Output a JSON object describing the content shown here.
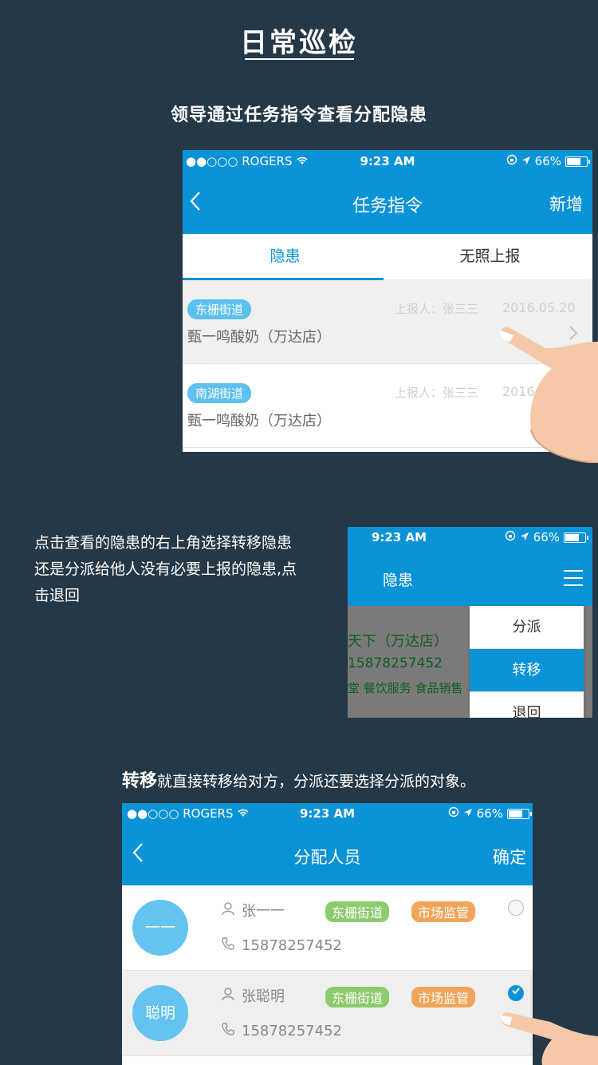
{
  "page": {
    "title": "日常巡检",
    "section1_heading": "领导通过任务指令查看分配隐患",
    "section2_text": "点击查看的隐患的右上角选择转移隐患还是分派给他人没有必要上报的隐患,点击退回",
    "section3_heading_bold": "转移",
    "section3_heading_rest": "就直接转移给对方，分派还要选择分派的对象。"
  },
  "status_bar": {
    "carrier": "●●○○○ ROGERS",
    "time": "9:23 AM",
    "battery": "66%"
  },
  "phone1": {
    "nav_title": "任务指令",
    "nav_action": "新增",
    "tabs": [
      "隐患",
      "无照上报"
    ],
    "items": [
      {
        "tag": "东栅街道",
        "reporter": "上报人：张三三",
        "date": "2016.05.20",
        "shop": "甄一鸣酸奶（万达店）"
      },
      {
        "tag": "南湖街道",
        "reporter": "上报人：张三三",
        "date": "2016",
        "shop": "甄一鸣酸奶（万达店）"
      }
    ]
  },
  "phone2": {
    "nav_title": "隐患",
    "background_lines": [
      "天下（万达店）",
      "15878257452",
      "堂  餐饮服务  食品销售"
    ],
    "menu": [
      "分派",
      "转移",
      "退回"
    ],
    "menu_selected": "转移"
  },
  "phone3": {
    "nav_title": "分配人员",
    "nav_action": "确定",
    "people": [
      {
        "avatar": "一一",
        "name": "张一一",
        "phone": "15878257452",
        "street": "东栅街道",
        "dept": "市场监管",
        "checked": false
      },
      {
        "avatar": "聪明",
        "name": "张聪明",
        "phone": "15878257452",
        "street": "东栅街道",
        "dept": "市场监管",
        "checked": true
      }
    ]
  },
  "colors": {
    "background": "#253847",
    "primary": "#0b93d7",
    "tag_blue": "#5dc0ef",
    "tag_green": "#8ccb6e",
    "tag_orange": "#f1a55a"
  }
}
